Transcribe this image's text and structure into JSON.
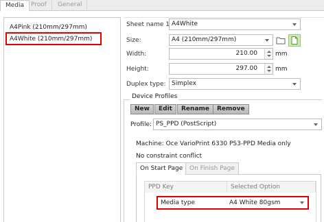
{
  "tabs": [
    "Media",
    "Proof",
    "General"
  ],
  "media_list": [
    "A4Pink (210mm/297mm)",
    "A4White (210mm/297mm)"
  ],
  "form": {
    "sheet_name_label": "Sheet name 1:",
    "sheet_name_value": "A4White",
    "size_label": "Size:",
    "size_value": "A4  (210mm/297mm)",
    "width_label": "Width:",
    "width_value": "210.00",
    "height_label": "Height:",
    "height_value": "297.00",
    "unit": "mm",
    "duplex_label": "Duplex type:",
    "duplex_value": "Simplex"
  },
  "device_profiles": {
    "title": "Device Profiles",
    "buttons": [
      "New",
      "Edit",
      "Rename",
      "Remove"
    ],
    "profile_label": "Profile:",
    "profile_value": "PS_PPD (PostScript)",
    "machine_text": "Machine: Oce VarioPrint 6330 PS3-PPD Media only",
    "constraint_text": "No constraint conflict",
    "inner_tabs": [
      "On Start Page",
      "On Finish Page"
    ],
    "table": {
      "headers": [
        "PPD Key",
        "Selected Option"
      ],
      "rows": [
        {
          "key": "Media type",
          "option": "A4 White 80gsm"
        }
      ]
    }
  },
  "icons": [
    "folder-icon",
    "new-page-icon"
  ],
  "colors": {
    "highlight": "#e00000",
    "new_icon_bg": "#cde9b4"
  }
}
